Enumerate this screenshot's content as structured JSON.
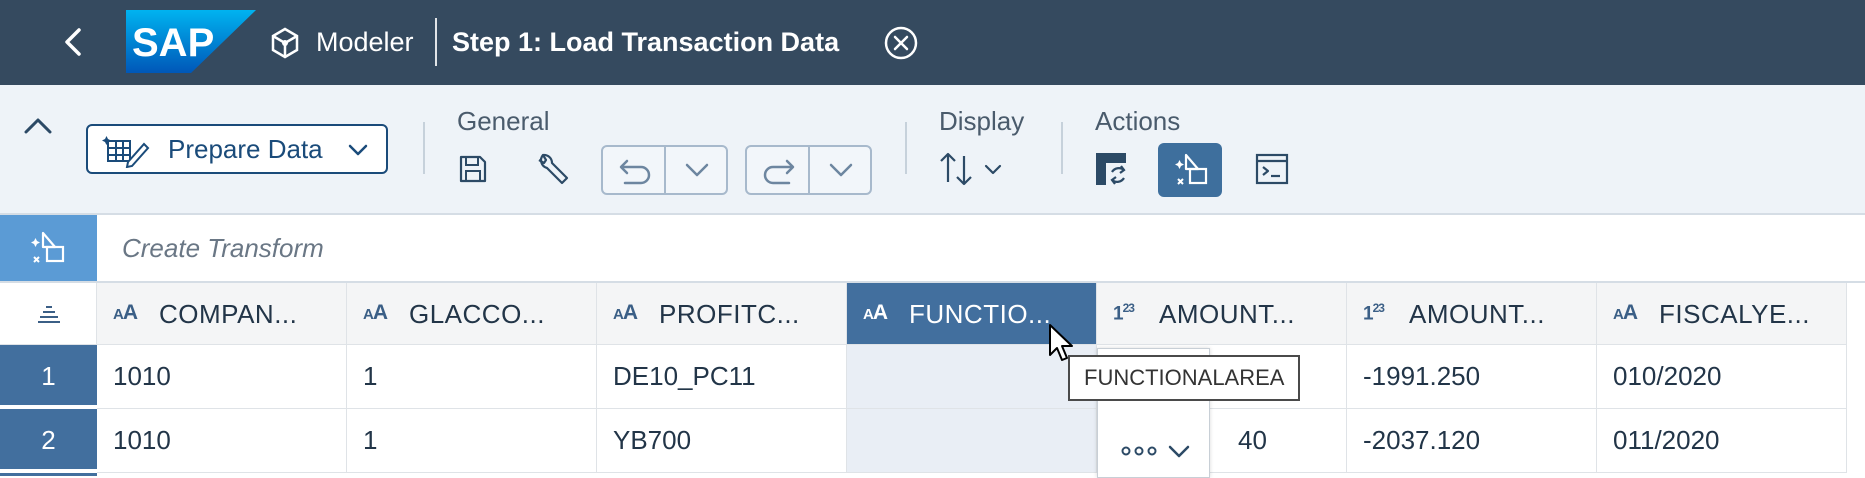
{
  "shellbar": {
    "logo_text": "SAP",
    "app_name": "Modeler",
    "title": "Step 1: Load Transaction Data",
    "icons": [
      "back-icon",
      "modeler-cube-icon",
      "close-circle-icon"
    ]
  },
  "toolbar": {
    "prepare_label": "Prepare Data",
    "general_title": "General",
    "display_title": "Display",
    "actions_title": "Actions",
    "icons": [
      "collapse-icon",
      "save-icon",
      "wrench-icon",
      "undo-icon",
      "redo-icon",
      "sort-icon",
      "transform-icon",
      "create-transform-icon",
      "console-icon"
    ]
  },
  "transform_bar": {
    "placeholder": "Create Transform"
  },
  "grid": {
    "columns": [
      {
        "type": "AA",
        "name": "COMPAN..."
      },
      {
        "type": "AA",
        "name": "GLACCO..."
      },
      {
        "type": "AA",
        "name": "PROFITC..."
      },
      {
        "type": "AA",
        "name": "FUNCTIO...",
        "selected": true
      },
      {
        "type": "123",
        "name": "AMOUNT..."
      },
      {
        "type": "123",
        "name": "AMOUNT..."
      },
      {
        "type": "AA",
        "name": "FISCALYE..."
      }
    ],
    "rows": [
      {
        "num": "1",
        "cells": [
          "1010",
          "1",
          "DE10_PC11",
          "",
          "",
          "-1991.250",
          "010/2020"
        ]
      },
      {
        "num": "2",
        "cells": [
          "1010",
          "1",
          "YB700",
          "",
          "40",
          "-2037.120",
          "011/2020"
        ]
      }
    ]
  },
  "tooltip": "FUNCTIONALAREA",
  "colors": {
    "shell": "#354a5f",
    "toolbar": "#eef3f8",
    "accent": "#426f9e",
    "transform_accent": "#5b9bd5"
  }
}
